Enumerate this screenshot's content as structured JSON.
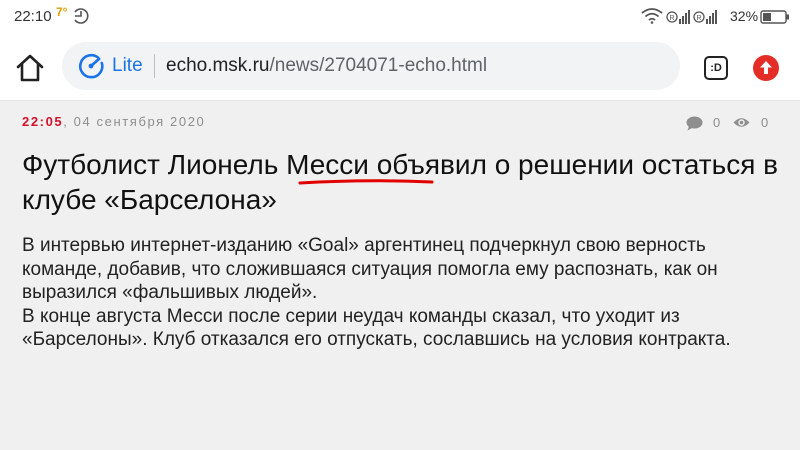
{
  "status_bar": {
    "time": "22:10",
    "temperature": "7°",
    "battery_percent": "32%",
    "icons": [
      "sync-icon",
      "wifi-icon",
      "signal-icon",
      "battery-icon"
    ]
  },
  "toolbar": {
    "mode_label": "Lite",
    "url_host": "echo.msk.ru",
    "url_path": "/news/2704071-echo.html",
    "extension_label": ":D",
    "icons": [
      "home-icon",
      "speedometer-icon",
      "extension-icon",
      "upload-icon"
    ]
  },
  "article": {
    "time": "22:05",
    "date": ", 04 сентября 2020",
    "comments_count": "0",
    "views_count": "0",
    "headline": "Футболист Лионель Месси объявил о решении остаться в клубе «Барселона»",
    "paragraphs": [
      "В интервью интернет-изданию «Goal» аргентинец подчеркнул свою верность команде, добавив, что сложившаяся ситуация помогла ему распознать, как он выразился «фальшивых людей».",
      "В конце августа Месси после серии неудач команды сказал, что уходит из «Барселоны». Клуб отказался его отпускать, сославшись на условия контракта."
    ]
  },
  "colors": {
    "accent_red": "#d3122b",
    "link_blue": "#1a73e8",
    "content_background": "#f0f0f0"
  }
}
